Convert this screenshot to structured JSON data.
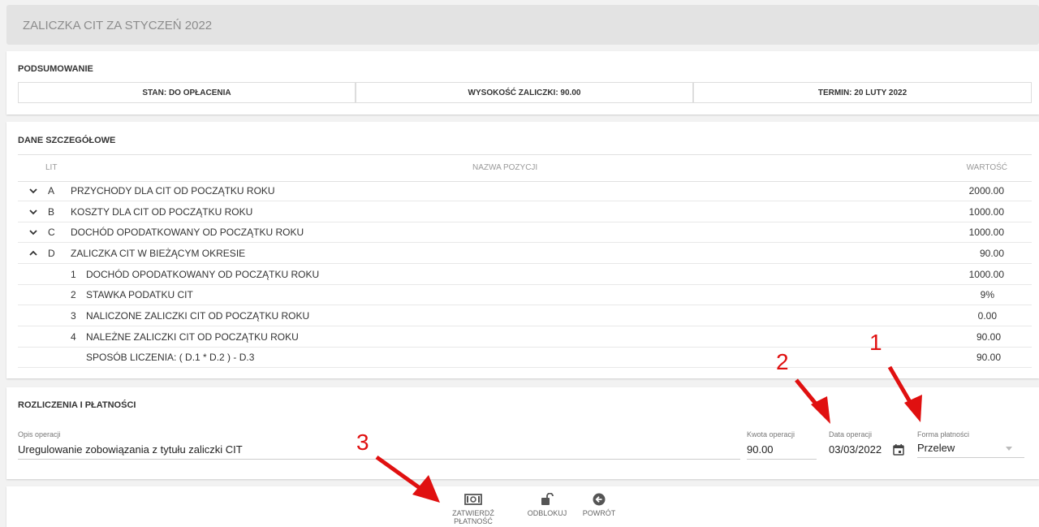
{
  "header": {
    "title": "ZALICZKA CIT ZA STYCZEŃ 2022"
  },
  "summary": {
    "title": "PODSUMOWANIE",
    "status": "STAN: DO OPŁACENIA",
    "amount": "WYSOKOŚĆ ZALICZKI: 90.00",
    "deadline": "TERMIN: 20 LUTY 2022"
  },
  "details": {
    "title": "DANE SZCZEGÓŁOWE",
    "columns": {
      "lit": "LIT",
      "name": "NAZWA POZYCJI",
      "value": "WARTOŚĆ"
    },
    "rows": [
      {
        "lit": "A",
        "name": "PRZYCHODY DLA CIT OD POCZĄTKU ROKU",
        "value": "2000.00"
      },
      {
        "lit": "B",
        "name": "KOSZTY DLA CIT OD POCZĄTKU ROKU",
        "value": "1000.00"
      },
      {
        "lit": "C",
        "name": "DOCHÓD OPODATKOWANY OD POCZĄTKU ROKU",
        "value": "1000.00"
      },
      {
        "lit": "D",
        "name": "ZALICZKA CIT W BIEŻĄCYM OKRESIE",
        "value": "90.00"
      }
    ],
    "subrows": [
      {
        "num": "1",
        "name": "DOCHÓD OPODATKOWANY OD POCZĄTKU ROKU",
        "value": "1000.00"
      },
      {
        "num": "2",
        "name": "STAWKA PODATKU CIT",
        "value": "9%"
      },
      {
        "num": "3",
        "name": "NALICZONE ZALICZKI CIT OD POCZĄTKU ROKU",
        "value": "0.00"
      },
      {
        "num": "4",
        "name": "NALEŻNE ZALICZKI CIT OD POCZĄTKU ROKU",
        "value": "90.00"
      }
    ],
    "formula": {
      "name": "SPOSÓB LICZENIA: ( D.1 * D.2 ) - D.3",
      "value": "90.00"
    }
  },
  "payments": {
    "title": "ROZLICZENIA I PŁATNOŚCI",
    "description": {
      "label": "Opis operacji",
      "value": "Uregulowanie zobowiązania z tytułu zaliczki CIT"
    },
    "amount": {
      "label": "Kwota operacji",
      "value": "90.00"
    },
    "date": {
      "label": "Data operacji",
      "value": "03/03/2022"
    },
    "method": {
      "label": "Forma płatności",
      "value": "Przelew"
    }
  },
  "toolbar": {
    "confirm": "ZATWIERDŹ PŁATNOŚĆ",
    "unlock": "ODBLOKUJ",
    "back": "POWRÓT"
  },
  "annotations": {
    "n1": "1",
    "n2": "2",
    "n3": "3",
    "color": "#e01010"
  },
  "icons": [
    "chevron-down-icon",
    "chevron-up-icon",
    "calendar-icon",
    "dropdown-arrow-icon",
    "money-icon",
    "unlock-icon",
    "back-arrow-icon"
  ]
}
